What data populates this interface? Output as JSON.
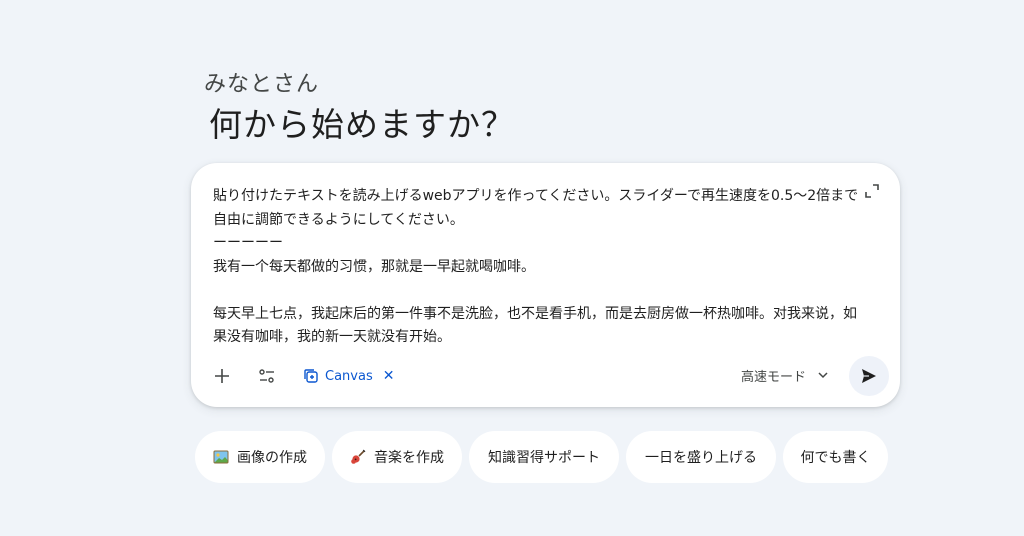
{
  "greeting": {
    "user": "みなとさん",
    "title": "何から始めますか？"
  },
  "composer": {
    "prompt_text": "貼り付けたテキストを読み上げるwebアプリを作ってください。スライダーで再生速度を0.5〜2倍まで自由に調節できるようにしてください。\nーーーーー\n我有一个每天都做的习惯，那就是一早起就喝咖啡。\n\n每天早上七点，我起床后的第一件事不是洗脸，也不是看手机，而是去厨房做一杯热咖啡。对我来说，如果没有咖啡，我的新一天就没有开始。",
    "canvas_chip_label": "Canvas",
    "chip_close_glyph": "✕",
    "mode_label": "高速モード",
    "icons": {
      "add": "plus-icon",
      "tools": "tune-icon",
      "canvas": "canvas-icon",
      "expand": "expand-icon",
      "dropdown": "chevron-down-icon",
      "send": "send-icon"
    }
  },
  "suggestions": [
    {
      "label": "画像の作成",
      "icon": "picture-emoji-icon"
    },
    {
      "label": "音楽を作成",
      "icon": "guitar-emoji-icon"
    },
    {
      "label": "知識習得サポート",
      "icon": ""
    },
    {
      "label": "一日を盛り上げる",
      "icon": ""
    },
    {
      "label": "何でも書く",
      "icon": ""
    }
  ],
  "colors": {
    "background": "#f0f4f9",
    "accent": "#0b57d0",
    "text": "#1f1f1f"
  }
}
